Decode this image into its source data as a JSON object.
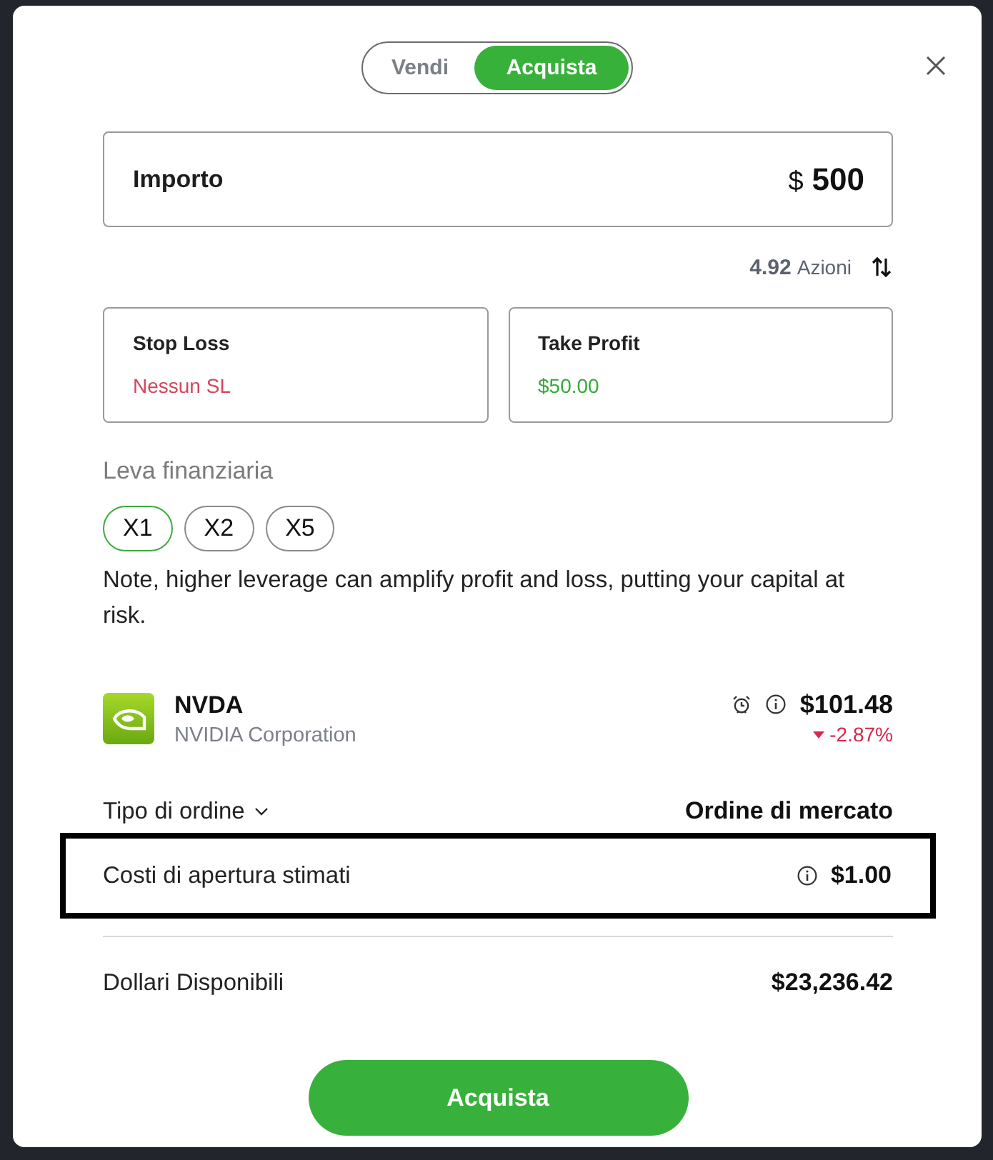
{
  "side_toggle": [
    {
      "label": "Vendi",
      "selected": false
    },
    {
      "label": "Acquista",
      "selected": true
    }
  ],
  "amount": {
    "label": "Importo",
    "currency": "$",
    "value": "500"
  },
  "shares": {
    "value": "4.92",
    "unit": "Azioni"
  },
  "protections": [
    {
      "label": "Stop Loss",
      "value": "Nessun SL",
      "color": "#d2465f"
    },
    {
      "label": "Take Profit",
      "value": "$50.00",
      "color": "#35a83a"
    }
  ],
  "leverage": {
    "label": "Leva finanziaria",
    "options": [
      {
        "label": "X1",
        "selected": true
      },
      {
        "label": "X2",
        "selected": false
      },
      {
        "label": "X5",
        "selected": false
      }
    ],
    "note": "Note, higher leverage can amplify profit and loss, putting your capital at risk."
  },
  "instrument": {
    "symbol": "NVDA",
    "name": "NVIDIA Corporation",
    "price": "$101.48",
    "change": "-2.87%",
    "falling": true
  },
  "order_rows": [
    {
      "kind": "dropdown",
      "label": "Tipo di ordine",
      "value": "Ordine di mercato",
      "highlighted": false
    },
    {
      "kind": "info",
      "label": "Costi di apertura stimati",
      "value": "$1.00",
      "highlighted": true
    }
  ],
  "balance": {
    "label": "Dollari Disponibili",
    "value": "$23,236.42"
  },
  "submit_button": "Acquista"
}
